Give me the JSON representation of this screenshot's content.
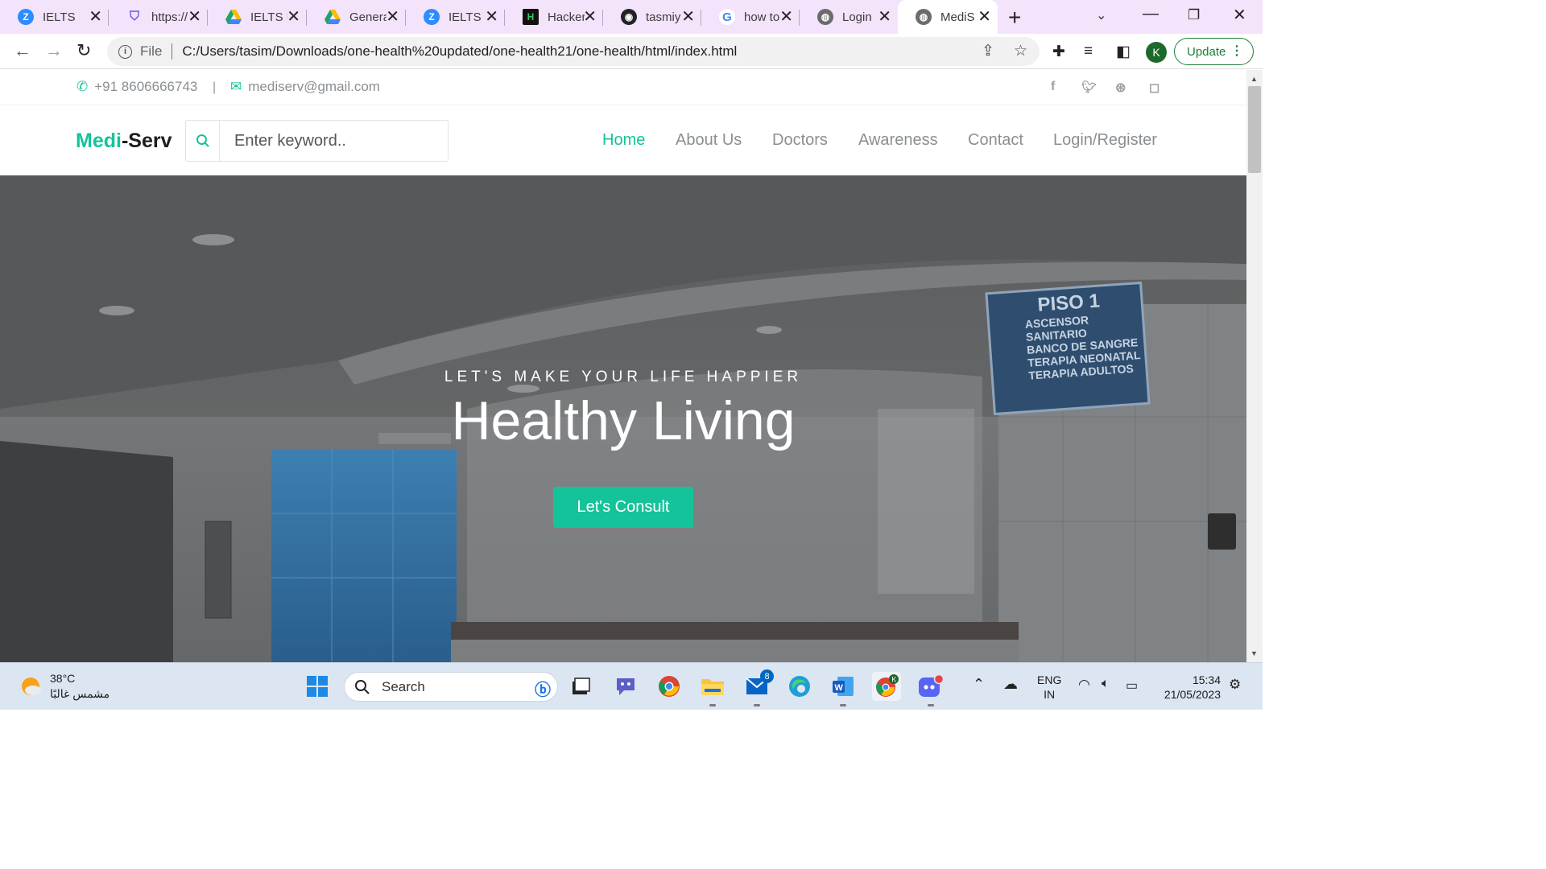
{
  "browser": {
    "tabs": [
      {
        "title": "IELTS P",
        "icon": "zoom-icon",
        "color": "#2d8cff",
        "glyph": "Z"
      },
      {
        "title": "https://",
        "icon": "shield-icon",
        "color": "#6c5ce7",
        "glyph": "⛉"
      },
      {
        "title": "IELTS U",
        "icon": "google-drive-icon",
        "color": "#1fa463",
        "glyph": "▲"
      },
      {
        "title": "Genera",
        "icon": "google-drive-icon",
        "color": "#1fa463",
        "glyph": "▲"
      },
      {
        "title": "IELTS P",
        "icon": "zoom-icon",
        "color": "#2d8cff",
        "glyph": "Z"
      },
      {
        "title": "Hacker",
        "icon": "hackerrank-icon",
        "color": "#111111",
        "glyph": "H"
      },
      {
        "title": "tasmiy",
        "icon": "github-icon",
        "color": "#222222",
        "glyph": "◉"
      },
      {
        "title": "how to",
        "icon": "google-icon",
        "color": "#ffffff",
        "glyph": "G"
      },
      {
        "title": "Login",
        "icon": "globe-icon",
        "color": "#6b6b6b",
        "glyph": "◍"
      },
      {
        "title": "MediS",
        "icon": "globe-icon",
        "color": "#6b6b6b",
        "glyph": "◍"
      }
    ],
    "active_tab_index": 9,
    "address": {
      "scheme_label": "File",
      "url": "C:/Users/tasim/Downloads/one-health%20updated/one-health21/one-health/html/index.html"
    },
    "profile_initial": "K",
    "update_label": "Update"
  },
  "site": {
    "topbar": {
      "phone": "+91 8606666743",
      "email": "mediserv@gmail.com",
      "divider": "|",
      "social": [
        "facebook-icon",
        "twitter-icon",
        "dribbble-icon",
        "instagram-icon"
      ]
    },
    "brand": {
      "part1": "Medi",
      "part2": "-Serv"
    },
    "search": {
      "placeholder": "Enter keyword.."
    },
    "nav": [
      "Home",
      "About Us",
      "Doctors",
      "Awareness",
      "Contact",
      "Login/Register"
    ],
    "nav_active": "Home",
    "hero": {
      "subtitle": "LET'S MAKE YOUR LIFE HAPPIER",
      "title": "Healthy Living",
      "cta": "Let's Consult",
      "sign": [
        "PISO 1",
        "ASCENSOR",
        "SANITARIO",
        "BANCO DE SANGRE",
        "TERAPIA NEONATAL",
        "TERAPIA ADULTOS"
      ]
    },
    "accent_color": "#15c39a"
  },
  "taskbar": {
    "weather": {
      "temp": "38°C",
      "desc": "مشمس غالبًا"
    },
    "search_label": "Search",
    "mail_badge": "8",
    "language": {
      "line1": "ENG",
      "line2": "IN"
    },
    "clock": {
      "time": "15:34",
      "date": "21/05/2023"
    }
  }
}
